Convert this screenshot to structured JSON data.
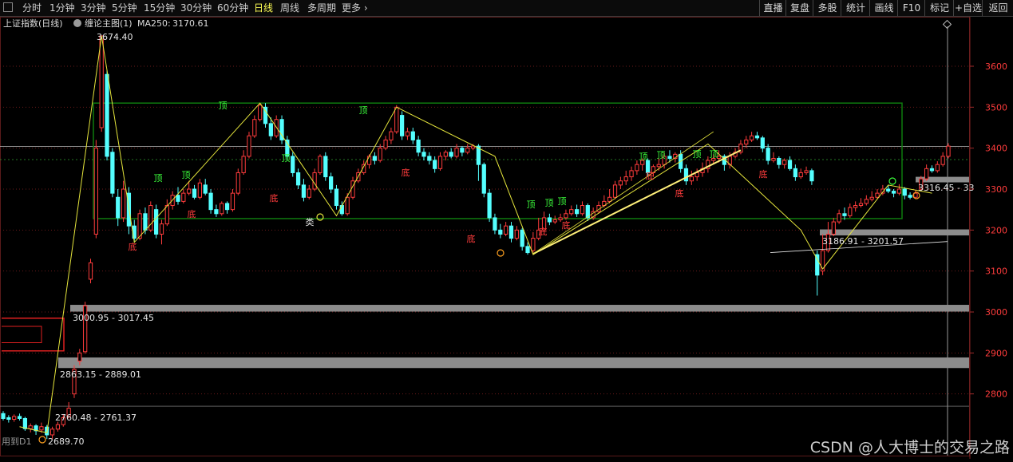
{
  "toolbar": {
    "timeframes": [
      "分时",
      "1分钟",
      "3分钟",
      "5分钟",
      "15分钟",
      "30分钟",
      "60分钟",
      "日线",
      "周线",
      "多周期",
      "更多"
    ],
    "active": "日线",
    "right_buttons": [
      "直播",
      "复盘",
      "多股",
      "统计",
      "画线",
      "F10",
      "标记",
      "+自选",
      "返回"
    ]
  },
  "header": {
    "title": "上证指数(日线)",
    "indicator": "缠论主图(1)",
    "ma_label": "MA250:",
    "ma_value": "3170.61"
  },
  "colors": {
    "up": "#ff3c3c",
    "down": "#54ffff",
    "zone": "#0e7a0e",
    "stroke": "#e6e63c",
    "gray_band": "#8c8c8c",
    "axis_text": "#ff3c3c",
    "top_label": "#3cff3c",
    "bottom_label": "#ff3c3c"
  },
  "chart_data": {
    "type": "candlestick",
    "y_ticks": [
      3600,
      3500,
      3400,
      3300,
      3200,
      3100,
      3000,
      2900,
      2800
    ],
    "ylim": [
      2680,
      3700
    ],
    "candles": [
      [
        2752,
        2740,
        2758,
        2735
      ],
      [
        2742,
        2738,
        2748,
        2730
      ],
      [
        2738,
        2745,
        2750,
        2732
      ],
      [
        2745,
        2740,
        2752,
        2735
      ],
      [
        2740,
        2715,
        2744,
        2710
      ],
      [
        2715,
        2722,
        2728,
        2706
      ],
      [
        2722,
        2710,
        2726,
        2700
      ],
      [
        2712,
        2720,
        2730,
        2705
      ],
      [
        2719,
        2700,
        2724,
        2690
      ],
      [
        2700,
        2714,
        2720,
        2690
      ],
      [
        2714,
        2725,
        2732,
        2708
      ],
      [
        2725,
        2742,
        2750,
        2720
      ],
      [
        2745,
        2765,
        2780,
        2740
      ],
      [
        2800,
        2860,
        2870,
        2790
      ],
      [
        2880,
        2900,
        2910,
        2870
      ],
      [
        2903,
        3015,
        3025,
        2898
      ],
      [
        3080,
        3120,
        3130,
        3070
      ],
      [
        3190,
        3400,
        3420,
        3180
      ],
      [
        3450,
        3674,
        3674,
        3440
      ],
      [
        3580,
        3380,
        3590,
        3370
      ],
      [
        3390,
        3290,
        3400,
        3280
      ],
      [
        3280,
        3230,
        3300,
        3210
      ],
      [
        3230,
        3300,
        3320,
        3220
      ],
      [
        3290,
        3210,
        3305,
        3190
      ],
      [
        3210,
        3180,
        3225,
        3170
      ],
      [
        3180,
        3240,
        3250,
        3175
      ],
      [
        3240,
        3200,
        3255,
        3190
      ],
      [
        3200,
        3260,
        3270,
        3195
      ],
      [
        3250,
        3190,
        3262,
        3180
      ],
      [
        3190,
        3215,
        3225,
        3165
      ],
      [
        3215,
        3260,
        3275,
        3210
      ],
      [
        3260,
        3285,
        3295,
        3250
      ],
      [
        3285,
        3270,
        3305,
        3262
      ],
      [
        3270,
        3290,
        3300,
        3265
      ],
      [
        3290,
        3300,
        3320,
        3285
      ],
      [
        3300,
        3280,
        3310,
        3275
      ],
      [
        3280,
        3315,
        3325,
        3275
      ],
      [
        3310,
        3290,
        3325,
        3285
      ],
      [
        3290,
        3250,
        3300,
        3240
      ],
      [
        3250,
        3240,
        3262,
        3232
      ],
      [
        3240,
        3265,
        3270,
        3235
      ],
      [
        3265,
        3250,
        3270,
        3240
      ],
      [
        3250,
        3290,
        3300,
        3245
      ],
      [
        3290,
        3340,
        3350,
        3285
      ],
      [
        3340,
        3380,
        3395,
        3335
      ],
      [
        3380,
        3430,
        3440,
        3375
      ],
      [
        3430,
        3470,
        3480,
        3425
      ],
      [
        3470,
        3505,
        3510,
        3465
      ],
      [
        3500,
        3460,
        3510,
        3450
      ],
      [
        3460,
        3430,
        3475,
        3420
      ],
      [
        3430,
        3470,
        3480,
        3425
      ],
      [
        3470,
        3420,
        3480,
        3410
      ],
      [
        3420,
        3380,
        3430,
        3370
      ],
      [
        3380,
        3340,
        3390,
        3330
      ],
      [
        3340,
        3310,
        3350,
        3300
      ],
      [
        3310,
        3280,
        3325,
        3270
      ],
      [
        3280,
        3300,
        3310,
        3275
      ],
      [
        3300,
        3340,
        3350,
        3295
      ],
      [
        3340,
        3380,
        3385,
        3335
      ],
      [
        3380,
        3330,
        3390,
        3320
      ],
      [
        3330,
        3300,
        3340,
        3290
      ],
      [
        3300,
        3260,
        3310,
        3250
      ],
      [
        3260,
        3240,
        3270,
        3235
      ],
      [
        3240,
        3280,
        3290,
        3235
      ],
      [
        3280,
        3320,
        3330,
        3275
      ],
      [
        3320,
        3340,
        3350,
        3315
      ],
      [
        3340,
        3360,
        3370,
        3335
      ],
      [
        3360,
        3380,
        3385,
        3350
      ],
      [
        3380,
        3370,
        3390,
        3360
      ],
      [
        3370,
        3400,
        3410,
        3365
      ],
      [
        3400,
        3420,
        3430,
        3395
      ],
      [
        3420,
        3440,
        3450,
        3410
      ],
      [
        3440,
        3500,
        3505,
        3435
      ],
      [
        3480,
        3430,
        3490,
        3420
      ],
      [
        3430,
        3440,
        3450,
        3420
      ],
      [
        3440,
        3420,
        3450,
        3410
      ],
      [
        3420,
        3390,
        3430,
        3380
      ],
      [
        3390,
        3380,
        3400,
        3370
      ],
      [
        3380,
        3370,
        3390,
        3360
      ],
      [
        3370,
        3350,
        3380,
        3340
      ],
      [
        3350,
        3380,
        3390,
        3345
      ],
      [
        3380,
        3390,
        3395,
        3370
      ],
      [
        3390,
        3380,
        3400,
        3375
      ],
      [
        3380,
        3400,
        3410,
        3375
      ],
      [
        3400,
        3390,
        3405,
        3380
      ],
      [
        3390,
        3400,
        3410,
        3385
      ],
      [
        3400,
        3405,
        3410,
        3395
      ],
      [
        3405,
        3360,
        3410,
        3320
      ],
      [
        3360,
        3290,
        3365,
        3280
      ],
      [
        3290,
        3230,
        3300,
        3220
      ],
      [
        3230,
        3200,
        3240,
        3190
      ],
      [
        3200,
        3190,
        3215,
        3180
      ],
      [
        3190,
        3210,
        3220,
        3185
      ],
      [
        3210,
        3180,
        3220,
        3170
      ],
      [
        3180,
        3200,
        3210,
        3175
      ],
      [
        3200,
        3160,
        3205,
        3150
      ],
      [
        3160,
        3145,
        3170,
        3140
      ],
      [
        3150,
        3180,
        3195,
        3145
      ],
      [
        3180,
        3200,
        3230,
        3175
      ],
      [
        3200,
        3230,
        3245,
        3195
      ],
      [
        3230,
        3220,
        3240,
        3212
      ],
      [
        3220,
        3225,
        3235,
        3215
      ],
      [
        3225,
        3230,
        3240,
        3220
      ],
      [
        3230,
        3240,
        3250,
        3225
      ],
      [
        3240,
        3250,
        3260,
        3235
      ],
      [
        3250,
        3240,
        3262,
        3232
      ],
      [
        3240,
        3260,
        3270,
        3235
      ],
      [
        3260,
        3230,
        3265,
        3222
      ],
      [
        3230,
        3245,
        3255,
        3225
      ],
      [
        3245,
        3260,
        3270,
        3240
      ],
      [
        3260,
        3270,
        3285,
        3255
      ],
      [
        3270,
        3280,
        3300,
        3265
      ],
      [
        3280,
        3310,
        3320,
        3275
      ],
      [
        3310,
        3320,
        3330,
        3300
      ],
      [
        3320,
        3330,
        3345,
        3310
      ],
      [
        3330,
        3345,
        3355,
        3320
      ],
      [
        3345,
        3360,
        3370,
        3335
      ],
      [
        3360,
        3370,
        3375,
        3345
      ],
      [
        3370,
        3340,
        3375,
        3330
      ],
      [
        3340,
        3355,
        3360,
        3330
      ],
      [
        3355,
        3360,
        3375,
        3345
      ],
      [
        3360,
        3380,
        3390,
        3350
      ],
      [
        3380,
        3375,
        3395,
        3365
      ],
      [
        3375,
        3385,
        3390,
        3365
      ],
      [
        3385,
        3350,
        3395,
        3340
      ],
      [
        3350,
        3320,
        3360,
        3310
      ],
      [
        3320,
        3330,
        3345,
        3310
      ],
      [
        3330,
        3340,
        3350,
        3320
      ],
      [
        3340,
        3350,
        3365,
        3330
      ],
      [
        3350,
        3370,
        3380,
        3340
      ],
      [
        3370,
        3375,
        3385,
        3360
      ],
      [
        3375,
        3380,
        3395,
        3365
      ],
      [
        3380,
        3360,
        3385,
        3345
      ],
      [
        3360,
        3380,
        3390,
        3350
      ],
      [
        3380,
        3390,
        3400,
        3375
      ],
      [
        3390,
        3410,
        3420,
        3385
      ],
      [
        3410,
        3420,
        3430,
        3400
      ],
      [
        3420,
        3430,
        3440,
        3415
      ],
      [
        3430,
        3425,
        3440,
        3420
      ],
      [
        3425,
        3400,
        3430,
        3390
      ],
      [
        3400,
        3370,
        3410,
        3360
      ],
      [
        3370,
        3375,
        3390,
        3365
      ],
      [
        3375,
        3360,
        3380,
        3350
      ],
      [
        3360,
        3370,
        3375,
        3350
      ],
      [
        3370,
        3350,
        3380,
        3345
      ],
      [
        3350,
        3330,
        3360,
        3320
      ],
      [
        3330,
        3340,
        3350,
        3325
      ],
      [
        3340,
        3345,
        3355,
        3335
      ],
      [
        3345,
        3320,
        3350,
        3310
      ],
      [
        3140,
        3090,
        3150,
        3040
      ],
      [
        3100,
        3150,
        3190,
        3090
      ],
      [
        3150,
        3190,
        3220,
        3145
      ],
      [
        3190,
        3220,
        3230,
        3185
      ],
      [
        3220,
        3240,
        3250,
        3215
      ],
      [
        3240,
        3235,
        3255,
        3225
      ],
      [
        3235,
        3255,
        3265,
        3230
      ],
      [
        3255,
        3260,
        3270,
        3245
      ],
      [
        3260,
        3265,
        3278,
        3255
      ],
      [
        3265,
        3275,
        3285,
        3260
      ],
      [
        3275,
        3280,
        3295,
        3270
      ],
      [
        3280,
        3290,
        3300,
        3275
      ],
      [
        3290,
        3300,
        3310,
        3285
      ],
      [
        3300,
        3295,
        3310,
        3290
      ],
      [
        3295,
        3290,
        3300,
        3280
      ],
      [
        3290,
        3300,
        3312,
        3285
      ],
      [
        3300,
        3285,
        3305,
        3275
      ],
      [
        3285,
        3280,
        3292,
        3275
      ],
      [
        3280,
        3290,
        3298,
        3278
      ],
      [
        3300,
        3325,
        3332,
        3295
      ],
      [
        3325,
        3350,
        3360,
        3320
      ],
      [
        3350,
        3345,
        3358,
        3340
      ],
      [
        3345,
        3360,
        3368,
        3340
      ],
      [
        3360,
        3380,
        3390,
        3355
      ],
      [
        3380,
        3405,
        3412,
        3375
      ]
    ],
    "zone": {
      "top": 3510,
      "bottom": 3228
    },
    "stroke_points": [
      [
        3,
        2720
      ],
      [
        8,
        2705
      ],
      [
        18,
        3674
      ],
      [
        24,
        3170
      ],
      [
        47,
        3510
      ],
      [
        61,
        3235
      ],
      [
        72,
        3500
      ],
      [
        90,
        3380
      ],
      [
        97,
        3140
      ],
      [
        129,
        3410
      ],
      [
        146,
        3200
      ],
      [
        150,
        3105
      ],
      [
        162,
        3310
      ],
      [
        170,
        3290
      ]
    ],
    "annotations": [
      {
        "text": "3674.40"
      },
      {
        "text": "3000.95 - 3017.45"
      },
      {
        "text": "2863.15 - 2889.01"
      },
      {
        "text": "2760.48 - 2761.37"
      },
      {
        "text": "3186.91 - 3201.57"
      },
      {
        "text": "3316.45 - 33"
      },
      {
        "text": "2689.70"
      },
      {
        "text": "用到D1"
      }
    ],
    "labels": [
      {
        "text": "顶",
        "kind": "top"
      },
      {
        "text": "底",
        "kind": "bottom"
      },
      {
        "text": "类",
        "kind": "other"
      }
    ]
  },
  "watermark": "CSDN @人大博士的交易之路"
}
